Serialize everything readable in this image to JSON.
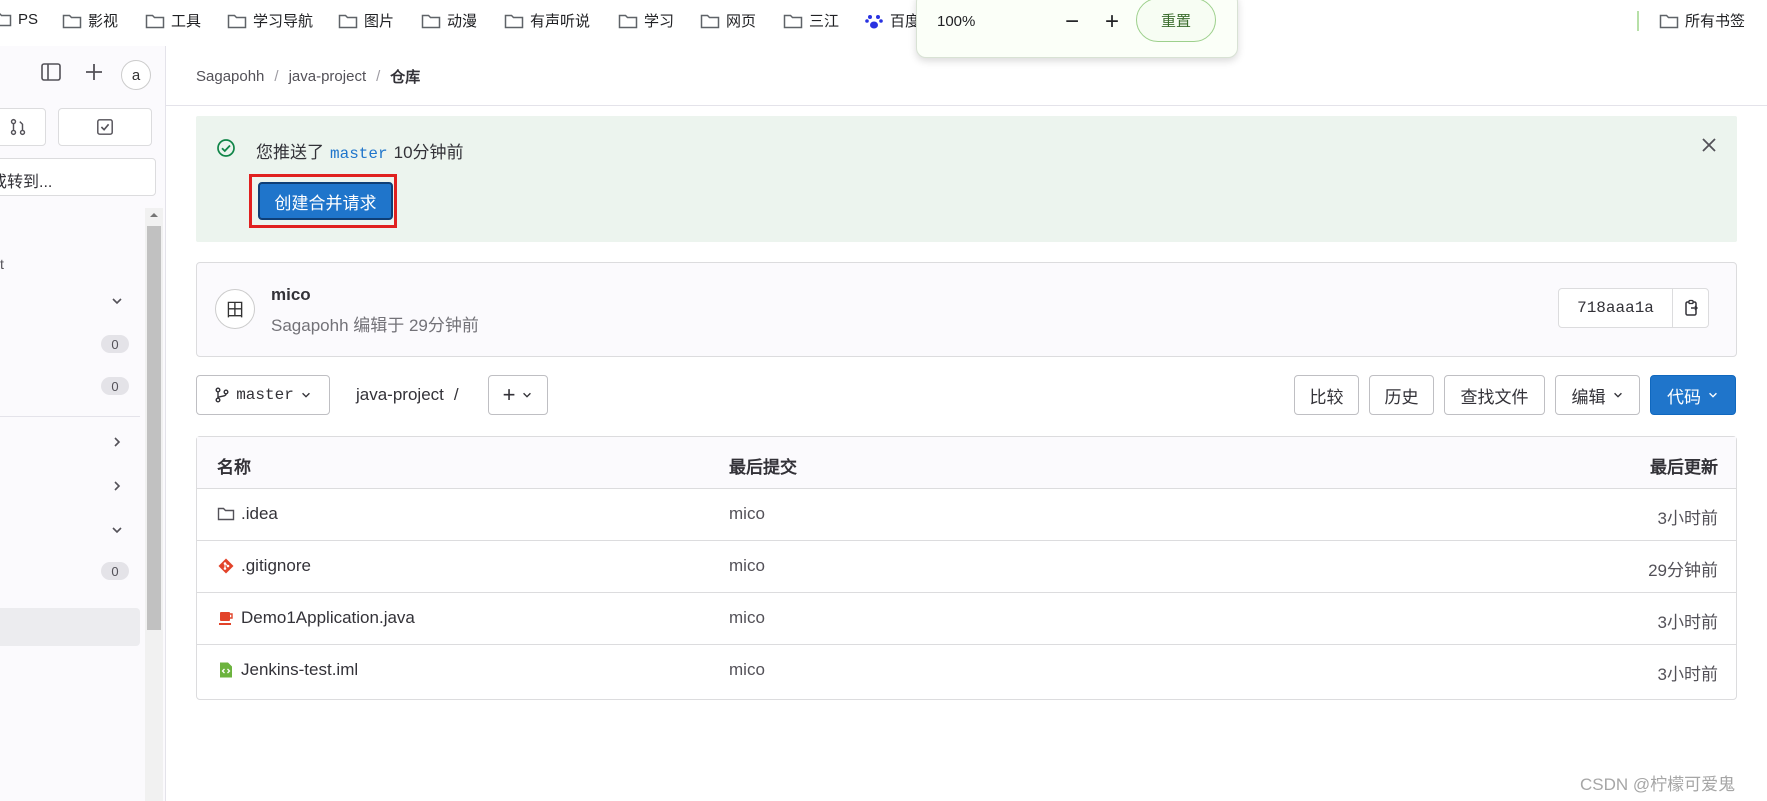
{
  "bookmarks": {
    "items": [
      {
        "label": "PS",
        "icon": "folder-icon"
      },
      {
        "label": "影视",
        "icon": "folder-icon"
      },
      {
        "label": "工具",
        "icon": "folder-icon"
      },
      {
        "label": "学习导航",
        "icon": "folder-icon"
      },
      {
        "label": "图片",
        "icon": "folder-icon"
      },
      {
        "label": "动漫",
        "icon": "folder-icon"
      },
      {
        "label": "有声听说",
        "icon": "folder-icon"
      },
      {
        "label": "学习",
        "icon": "folder-icon"
      },
      {
        "label": "网页",
        "icon": "folder-icon"
      },
      {
        "label": "三江",
        "icon": "folder-icon"
      },
      {
        "label": "百度",
        "icon": "paw-icon"
      }
    ],
    "all_bookmarks": "所有书签"
  },
  "zoom_popup": {
    "value": "100%",
    "minus": "−",
    "plus": "+",
    "reset": "重置"
  },
  "sidebar": {
    "avatar_alt": "a",
    "search_fragment": "或转到...",
    "section_fragment": "t",
    "badges": [
      "0",
      "0",
      "0"
    ]
  },
  "breadcrumb": {
    "items": [
      "Sagapohh",
      "java-project"
    ],
    "current": "仓库",
    "separator": "/"
  },
  "alert": {
    "text_prefix": "您推送了",
    "branch": "master",
    "text_suffix": "10分钟前",
    "button": "创建合并请求",
    "highlight_color": "#e0201f"
  },
  "commit": {
    "avatar_fallback": "田",
    "author": "mico",
    "meta": "Sagapohh 编辑于 29分钟前",
    "sha": "718aaa1a"
  },
  "toolbar": {
    "branch": "master",
    "path": "java-project",
    "path_sep": "/",
    "add_label": "+",
    "compare": "比较",
    "history": "历史",
    "find_file": "查找文件",
    "edit": "编辑",
    "code": "代码"
  },
  "table": {
    "headers": {
      "name": "名称",
      "last_commit": "最后提交",
      "last_update": "最后更新"
    },
    "rows": [
      {
        "name": ".idea",
        "icon": "folder-icon",
        "commit": "mico",
        "time": "3小时前"
      },
      {
        "name": ".gitignore",
        "icon": "git-icon",
        "commit": "mico",
        "time": "29分钟前"
      },
      {
        "name": "Demo1Application.java",
        "icon": "java-icon",
        "commit": "mico",
        "time": "3小时前"
      },
      {
        "name": "Jenkins-test.iml",
        "icon": "code-file-icon",
        "commit": "mico",
        "time": "3小时前"
      }
    ]
  },
  "watermark": "CSDN @柠檬可爱鬼",
  "colors": {
    "primary": "#1f75cb",
    "alert_bg": "#ecf4ee",
    "success": "#108548"
  }
}
